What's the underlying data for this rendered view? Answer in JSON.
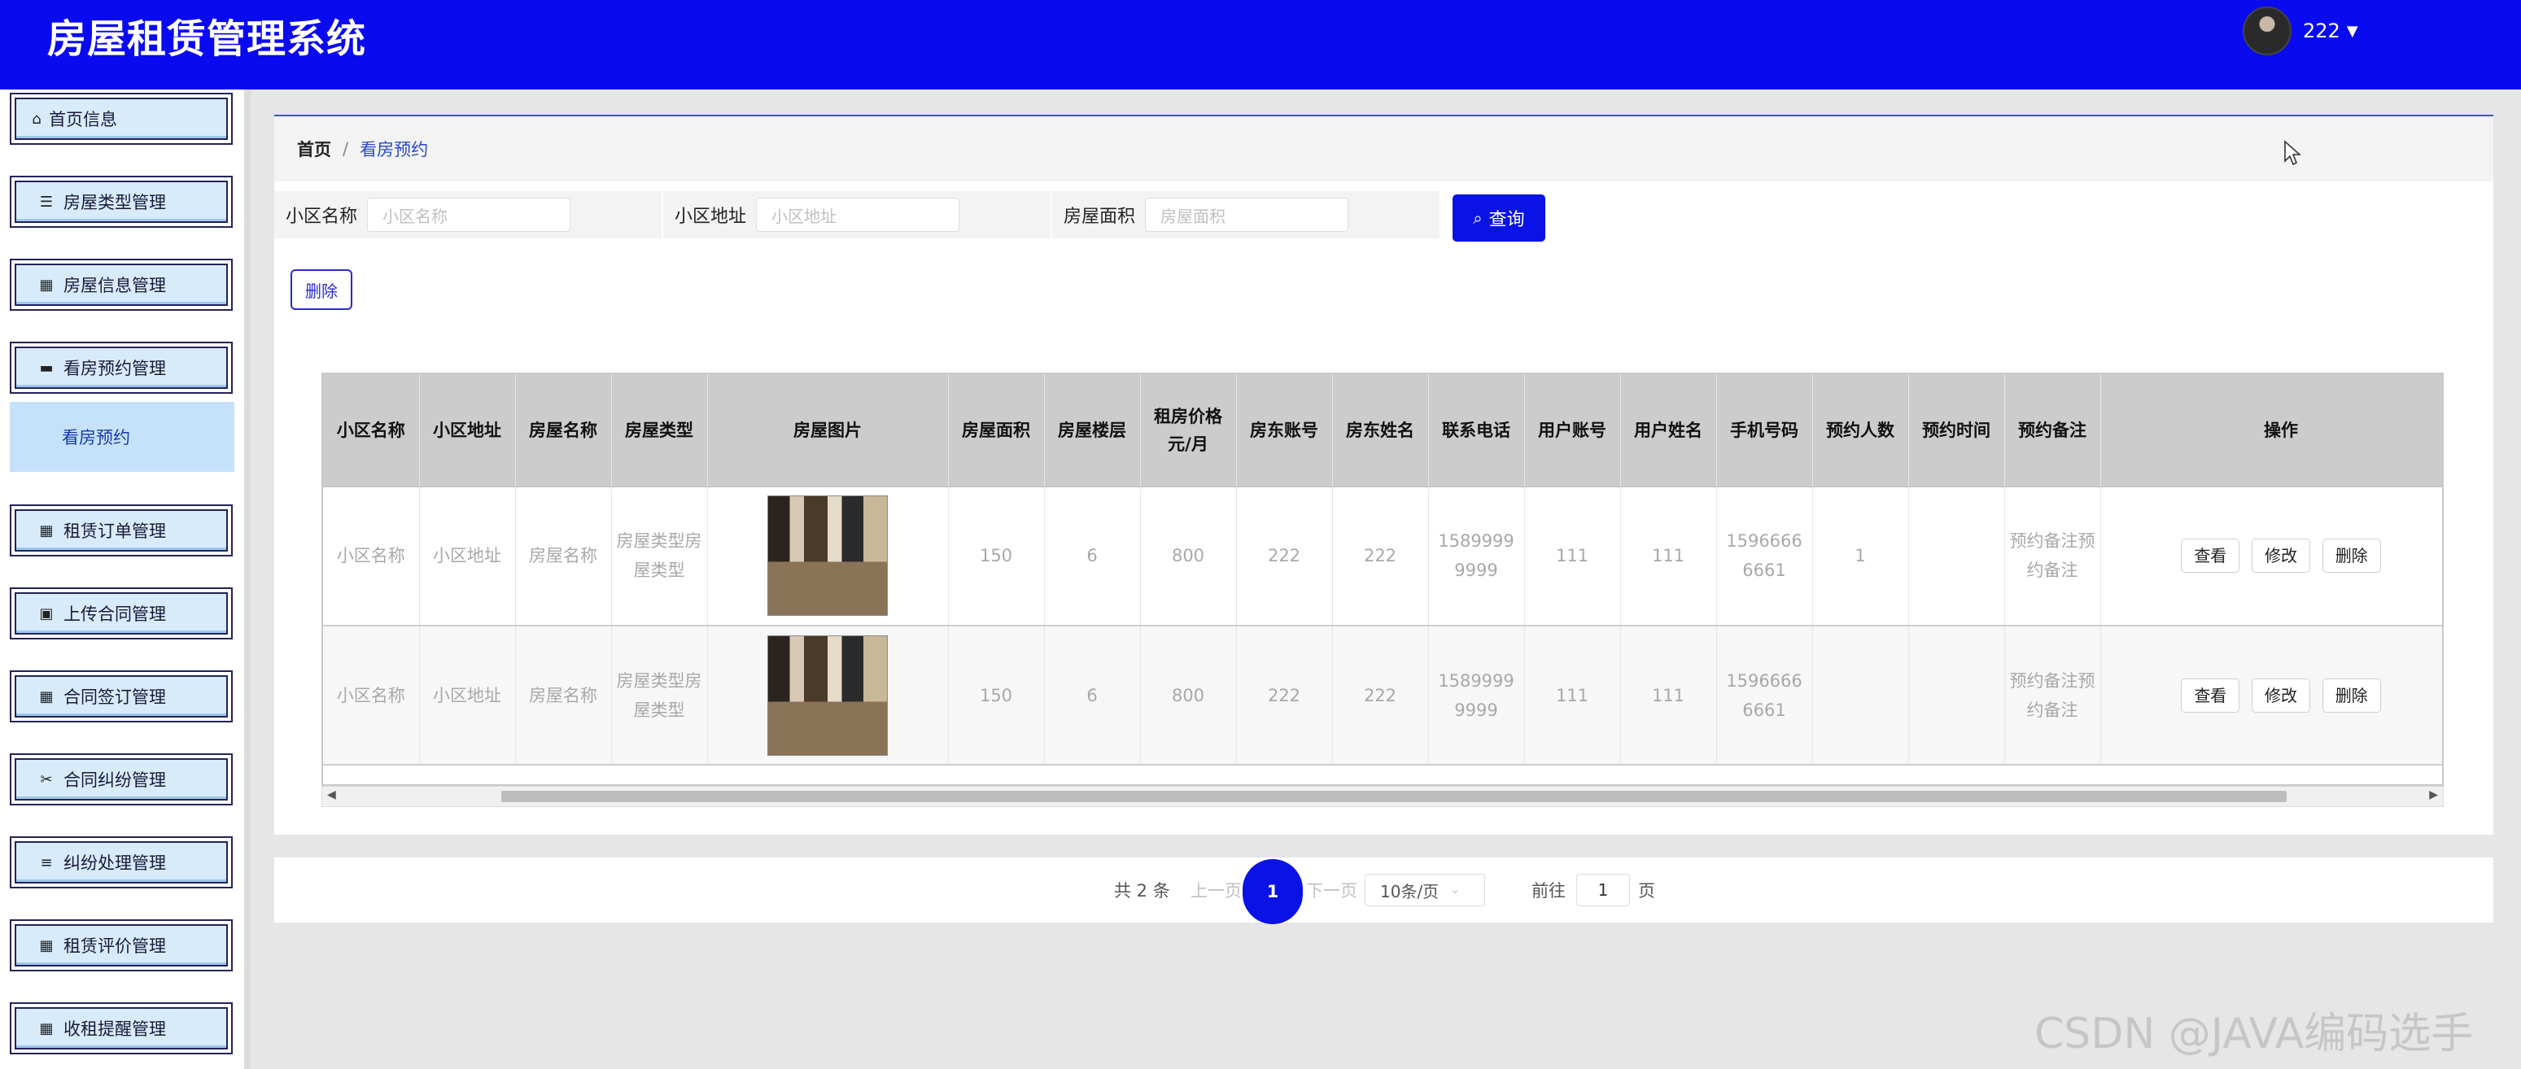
{
  "app": {
    "title": "房屋租赁管理系统"
  },
  "user": {
    "name": "222"
  },
  "sidebar": {
    "items": [
      {
        "label": "首页信息",
        "icon": "home-icon"
      },
      {
        "label": "房屋类型管理",
        "icon": "sliders-icon"
      },
      {
        "label": "房屋信息管理",
        "icon": "grid-icon"
      },
      {
        "label": "看房预约管理",
        "icon": "briefcase-icon"
      },
      {
        "label": "租赁订单管理",
        "icon": "grid-icon"
      },
      {
        "label": "上传合同管理",
        "icon": "printer-icon"
      },
      {
        "label": "合同签订管理",
        "icon": "grid-icon"
      },
      {
        "label": "合同纠纷管理",
        "icon": "ticket-icon"
      },
      {
        "label": "纠纷处理管理",
        "icon": "list-icon"
      },
      {
        "label": "租赁评价管理",
        "icon": "grid-icon"
      },
      {
        "label": "收租提醒管理",
        "icon": "grid-icon"
      }
    ],
    "submenu_active": "看房预约"
  },
  "breadcrumb": {
    "home": "首页",
    "separator": "/",
    "current": "看房预约"
  },
  "search": {
    "fields": [
      {
        "label": "小区名称",
        "placeholder": "小区名称"
      },
      {
        "label": "小区地址",
        "placeholder": "小区地址"
      },
      {
        "label": "房屋面积",
        "placeholder": "房屋面积"
      }
    ],
    "query_label": "查询"
  },
  "toolbar": {
    "delete_label": "删除"
  },
  "table": {
    "columns": [
      "小区名称",
      "小区地址",
      "房屋名称",
      "房屋类型",
      "房屋图片",
      "房屋面积",
      "房屋楼层",
      "租房价格元/月",
      "房东账号",
      "房东姓名",
      "联系电话",
      "用户账号",
      "用户姓名",
      "手机号码",
      "预约人数",
      "预约时间",
      "预约备注",
      "操作"
    ],
    "rows": [
      {
        "community": "小区名称",
        "address": "小区地址",
        "house_name": "房屋名称",
        "house_type": "房屋类型房屋类型",
        "area": "150",
        "floor": "6",
        "price": "800",
        "landlord_account": "222",
        "landlord_name": "222",
        "phone": "15899999999",
        "user_account": "111",
        "user_name": "111",
        "mobile": "15966666661",
        "people": "1",
        "time": "",
        "remark": "预约备注预约备注"
      },
      {
        "community": "小区名称",
        "address": "小区地址",
        "house_name": "房屋名称",
        "house_type": "房屋类型房屋类型",
        "area": "150",
        "floor": "6",
        "price": "800",
        "landlord_account": "222",
        "landlord_name": "222",
        "phone": "15899999999",
        "user_account": "111",
        "user_name": "111",
        "mobile": "15966666661",
        "people": "",
        "time": "",
        "remark": "预约备注预约备注"
      }
    ],
    "actions": {
      "view": "查看",
      "edit": "修改",
      "delete": "删除"
    }
  },
  "pagination": {
    "total_text": "共 2 条",
    "prev": "上一页",
    "current_page": "1",
    "next": "下一页",
    "page_size": "10条/页",
    "goto_label": "前往",
    "goto_value": "1",
    "page_unit": "页"
  },
  "watermark": "CSDN @JAVA编码选手",
  "colors": {
    "header": "#0a0af0",
    "primary_button": "#0a12e6",
    "menu_bg": "#d7ebfb"
  }
}
